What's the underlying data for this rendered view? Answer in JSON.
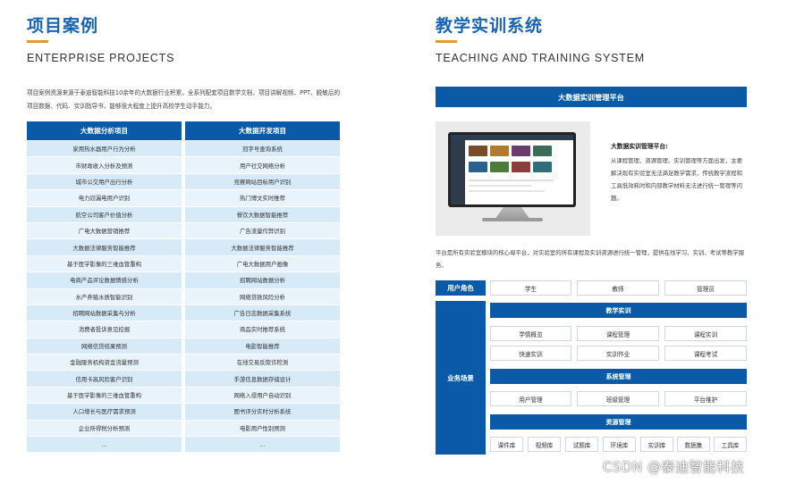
{
  "left": {
    "title": "项目案例",
    "subtitle": "ENTERPRISE PROJECTS",
    "intro": "项目案例资源来源于泰迪智能科技10余年的大数据行业积累，全系列配套项目数学文档，项目讲解视频、PPT、脱敏后的项目数据、代码、实训指导书，能够很大程度上提升高校学生动手能力。",
    "table_a": {
      "header": "大数据分析项目",
      "rows": [
        "家用热水器用户行为分析",
        "市财政收入分析及预测",
        "城市公交用户出行分析",
        "电力窃漏电用户识别",
        "航空公司客户价值分析",
        "广电大数据营销推荐",
        "大数据法律服务智能推荐",
        "基于医学影像的三维血管重构",
        "电商产品评论数据情感分析",
        "水产养殖水质智能识别",
        "招聘网站数据采集与分析",
        "消费者投诉意见挖掘",
        "网络信贷结果预测",
        "金融服务机构资金流量预测",
        "信用卡高风险客户识别",
        "基于医学影像的三维血管重构",
        "人口增长与医疗需求预测",
        "企业所得税分析预测",
        "..."
      ]
    },
    "table_b": {
      "header": "大数据开发项目",
      "rows": [
        "冠字号查询系统",
        "用户社交网络分析",
        "竞赛网站目标用户识别",
        "热门博文实时推荐",
        "餐饮大数据智能推荐",
        "广告流量作弊识别",
        "大数据法律服务智能推荐",
        "广电大数据用户画像",
        "招聘网站数据分析",
        "网络贷款风险分析",
        "广告日志数据采集系统",
        "商品实时推荐系统",
        "电影智能推荐",
        "在线交易反欺诈检测",
        "手游信息数据存储设计",
        "网络入侵用户自动识别",
        "图书评分实时分析系统",
        "电影用户性别预测",
        "..."
      ]
    }
  },
  "right": {
    "title": "教学实训系统",
    "subtitle": "TEACHING AND TRAINING SYSTEM",
    "banner": "大数据实训管理平台",
    "platform_title": "大数据实训管理平台:",
    "platform_desc": "从课程管理、资源管理、实训管理等方面出发，主要解决现有实验室无法满足教学需求、传统教学流程和工具低效耗时和内部教学材料无法进行统一管理等问题。",
    "platform_para": "平台是所有实验室模块的核心母平台，对实验室的所有课程及实训资源进行统一管理，提供在线学习、实训、考试等教学服务。",
    "user_role_label": "用户角色",
    "roles": [
      "学生",
      "教师",
      "管理员"
    ],
    "business_label": "业务场景",
    "sections": [
      {
        "title": "教学实训",
        "items": [
          "学情概览",
          "课程管理",
          "课程实训",
          "快速实训",
          "实训作业",
          "课程考试"
        ]
      },
      {
        "title": "系统管理",
        "items": [
          "用户管理",
          "班级管理",
          "平台维护"
        ]
      },
      {
        "title": "资源管理",
        "items": [
          "课件库",
          "视频库",
          "试题库",
          "环境库",
          "实训库",
          "数据集",
          "工具库"
        ]
      }
    ]
  },
  "watermark": "CSDN @泰迪智能科技",
  "colors": {
    "primary": "#0a5aa8",
    "accent": "#e39b2b",
    "row_light": "#d6eaf8",
    "row_lighter": "#e8f3fb"
  }
}
